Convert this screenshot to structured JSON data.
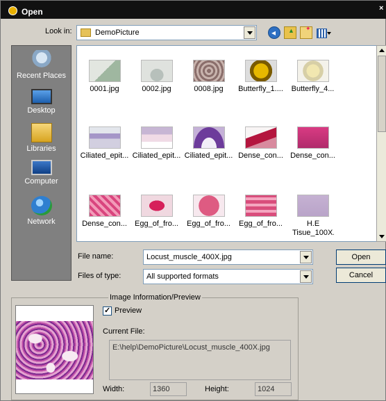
{
  "window": {
    "title": "Open",
    "close_glyph": "×"
  },
  "toolbar": {
    "look_in_label": "Look in:",
    "look_in_value": "DemoPicture",
    "icons": [
      "back-icon",
      "up-folder-icon",
      "new-folder-icon",
      "view-menu-icon"
    ]
  },
  "places": [
    {
      "label": "Recent Places",
      "icon": "recent-places-icon"
    },
    {
      "label": "Desktop",
      "icon": "desktop-icon"
    },
    {
      "label": "Libraries",
      "icon": "libraries-icon"
    },
    {
      "label": "Computer",
      "icon": "computer-icon"
    },
    {
      "label": "Network",
      "icon": "network-icon"
    }
  ],
  "files": [
    {
      "name": "0001.jpg"
    },
    {
      "name": "0002.jpg"
    },
    {
      "name": "0008.jpg"
    },
    {
      "name": "Butterfly_1...."
    },
    {
      "name": "Butterfly_4..."
    },
    {
      "name": "Ciliated_epit..."
    },
    {
      "name": "Ciliated_epit..."
    },
    {
      "name": "Ciliated_epit..."
    },
    {
      "name": "Dense_con..."
    },
    {
      "name": "Dense_con..."
    },
    {
      "name": "Dense_con..."
    },
    {
      "name": "Egg_of_fro..."
    },
    {
      "name": "Egg_of_fro..."
    },
    {
      "name": "Egg_of_fro..."
    },
    {
      "name": "H.E Tisue_100X..."
    }
  ],
  "form": {
    "file_name_label": "File name:",
    "file_name_value": "Locust_muscle_400X.jpg",
    "files_of_type_label": "Files of type:",
    "files_of_type_value": "All supported formats",
    "open_label": "Open",
    "cancel_label": "Cancel"
  },
  "preview": {
    "legend": "Image Information/Preview",
    "preview_label": "Preview",
    "preview_checked": true,
    "current_file_label": "Current File:",
    "current_file_value": "E:\\help\\DemoPicture\\Locust_muscle_400X.jpg",
    "width_label": "Width:",
    "width_value": "1360",
    "height_label": "Height:",
    "height_value": "1024"
  }
}
